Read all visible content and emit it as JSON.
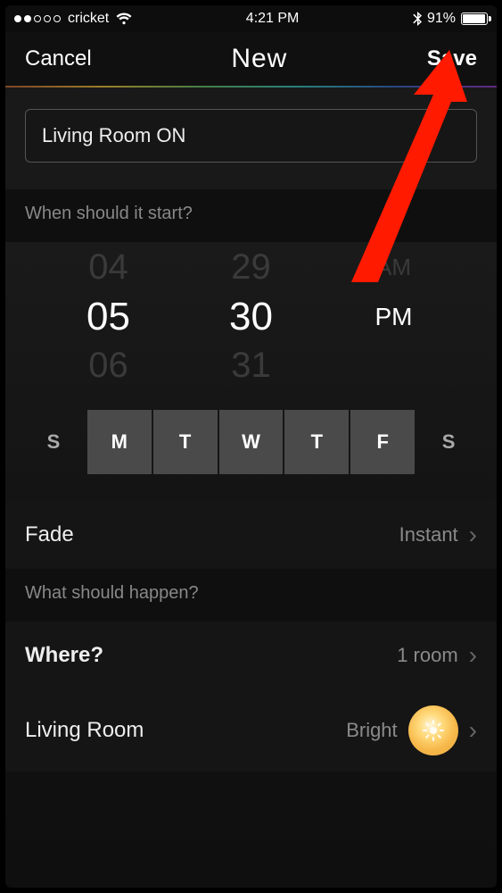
{
  "status": {
    "carrier": "cricket",
    "time": "4:21 PM",
    "battery_pct": "91%",
    "signal_filled": 2,
    "signal_total": 5
  },
  "nav": {
    "cancel": "Cancel",
    "title": "New",
    "save": "Save"
  },
  "name": {
    "value": "Living Room ON"
  },
  "sections": {
    "when": "When should it start?",
    "what": "What should happen?"
  },
  "picker": {
    "hour_prev": "04",
    "hour": "05",
    "hour_next": "06",
    "min_prev": "29",
    "min": "30",
    "min_next": "31",
    "mer_prev": "AM",
    "mer": "PM"
  },
  "days": [
    {
      "label": "S",
      "selected": false
    },
    {
      "label": "M",
      "selected": true
    },
    {
      "label": "T",
      "selected": true
    },
    {
      "label": "W",
      "selected": true
    },
    {
      "label": "T",
      "selected": true
    },
    {
      "label": "F",
      "selected": true
    },
    {
      "label": "S",
      "selected": false
    }
  ],
  "rows": {
    "fade": {
      "label": "Fade",
      "value": "Instant"
    },
    "where": {
      "label": "Where?",
      "value": "1 room"
    },
    "scene": {
      "label": "Living Room",
      "value": "Bright"
    }
  }
}
